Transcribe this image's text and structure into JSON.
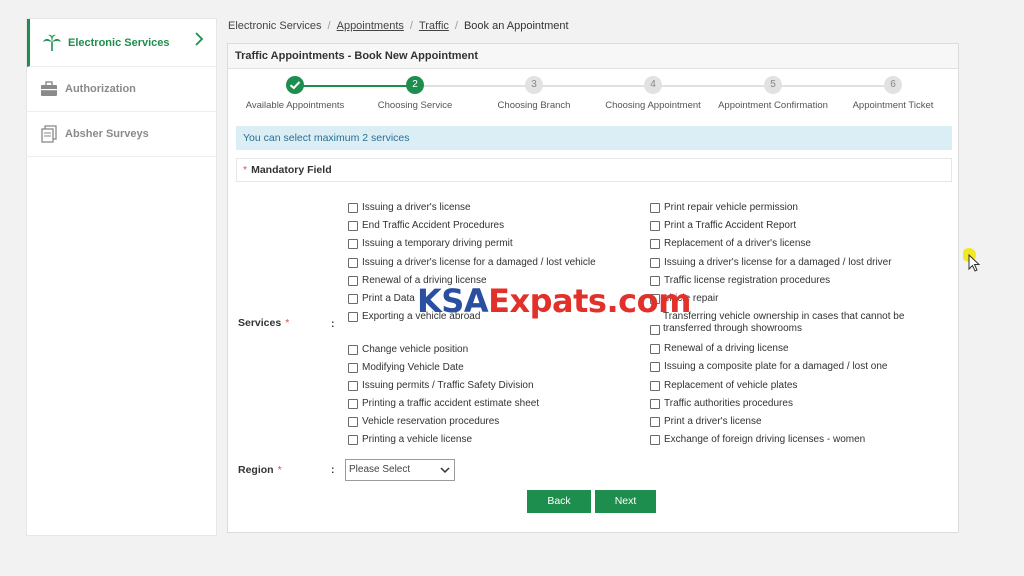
{
  "sidebar": {
    "items": [
      {
        "label": "Electronic Services",
        "icon": "palm-tree-logo-icon",
        "active": true
      },
      {
        "label": "Authorization",
        "icon": "briefcase-icon"
      },
      {
        "label": "Absher Surveys",
        "icon": "documents-icon"
      }
    ]
  },
  "breadcrumb": {
    "root": "Electronic Services",
    "appointments": "Appointments",
    "traffic": "Traffic",
    "current": "Book an Appointment"
  },
  "card": {
    "title": "Traffic Appointments - Book New Appointment"
  },
  "steps": [
    {
      "num": "✓",
      "label": "Available Appointments",
      "state": "done"
    },
    {
      "num": "2",
      "label": "Choosing Service",
      "state": "active"
    },
    {
      "num": "3",
      "label": "Choosing Branch",
      "state": "pending"
    },
    {
      "num": "4",
      "label": "Choosing Appointment",
      "state": "pending"
    },
    {
      "num": "5",
      "label": "Appointment Confirmation",
      "state": "pending"
    },
    {
      "num": "6",
      "label": "Appointment Ticket",
      "state": "pending"
    }
  ],
  "info": "You can select maximum 2 services",
  "mandatory": "Mandatory Field",
  "services": {
    "label": "Services",
    "left": [
      "Issuing a driver's license",
      "End Traffic Accident Procedures",
      "Issuing a temporary driving permit",
      "Issuing a driver's license for a damaged / lost vehicle",
      "Renewal of a driving license",
      "Print a Data",
      "Exporting a vehicle abroad",
      "Change vehicle position",
      "Modifying Vehicle Date",
      "Issuing permits / Traffic Safety Division",
      "Printing a traffic accident estimate sheet",
      "Vehicle reservation procedures",
      "Printing a vehicle license"
    ],
    "right": [
      "Print repair vehicle permission",
      "Print a Traffic Accident Report",
      "Replacement of a driver's license",
      "Issuing a driver's license for a damaged / lost driver",
      "Traffic license registration procedures",
      "ehicle repair",
      "Transferring vehicle ownership in cases that cannot be transferred through showrooms",
      "Renewal of a driving license",
      "Issuing a composite plate for a damaged / lost one",
      "Replacement of vehicle plates",
      "Traffic authorities procedures",
      "Print a driver's license",
      "Exchange of foreign driving licenses - women"
    ]
  },
  "region": {
    "label": "Region",
    "selected": "Please Select"
  },
  "buttons": {
    "back": "Back",
    "next": "Next"
  },
  "watermark": {
    "part1": "KSA",
    "part2": "Expats.com"
  },
  "colors": {
    "accent": "#1e8e4e",
    "info_bg": "#dbeef6",
    "required": "#d9534f"
  }
}
